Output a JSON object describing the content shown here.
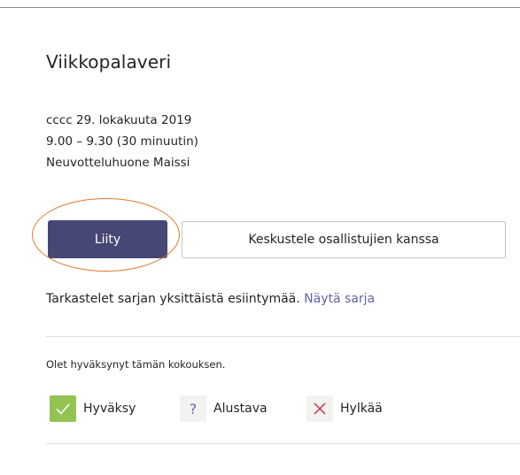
{
  "meeting": {
    "title": "Viikkopalaveri",
    "date": "cccc 29. lokakuuta 2019",
    "time": "9.00 – 9.30 (30 minuutin)",
    "location": "Neuvotteluhuone Maissi"
  },
  "actions": {
    "join_label": "Liity",
    "chat_label": "Keskustele osallistujien kanssa"
  },
  "series": {
    "text": "Tarkastelet sarjan yksittäistä esiintymää.",
    "link": "Näytä sarja"
  },
  "rsvp": {
    "status_text": "Olet hyväksynyt tämän kokouksen.",
    "accept_label": "Hyväksy",
    "tentative_label": "Alustava",
    "tentative_glyph": "?",
    "decline_label": "Hylkää"
  },
  "colors": {
    "brand": "#464775",
    "link": "#6264a7",
    "accept": "#92c353",
    "decline": "#c4314b",
    "highlight_ring": "#e07b2a"
  },
  "icons": {
    "accept": "checkmark-icon",
    "tentative": "question-icon",
    "decline": "close-icon"
  }
}
